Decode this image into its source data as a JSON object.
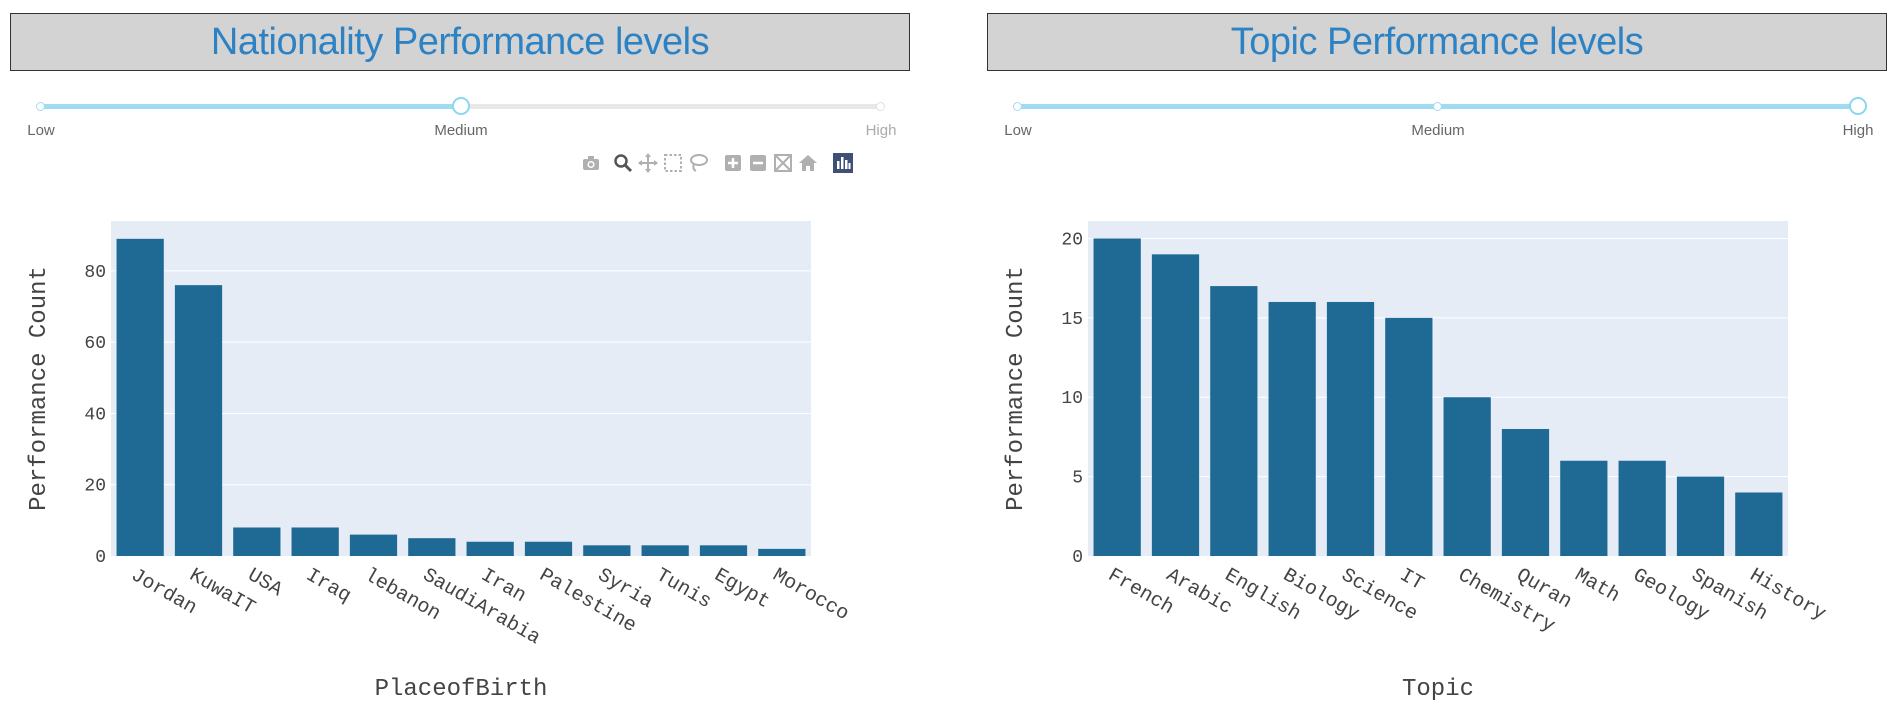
{
  "panels": {
    "left": {
      "title": "Nationality Performance levels",
      "slider": {
        "marks": [
          "Low",
          "Medium",
          "High"
        ],
        "value_index": 1
      }
    },
    "right": {
      "title": "Topic Performance levels",
      "slider": {
        "marks": [
          "Low",
          "Medium",
          "High"
        ],
        "value_index": 2
      }
    }
  },
  "modebar": {
    "icons": [
      "camera-icon",
      "zoom-icon",
      "pan-icon",
      "box-select-icon",
      "lasso-select-icon",
      "zoom-in-icon",
      "zoom-out-icon",
      "autoscale-icon",
      "reset-axes-icon",
      "plotly-logo-icon"
    ]
  },
  "colors": {
    "bar": "#1f6995",
    "plot_bg": "#e5ecf6",
    "title": "#2d82c4",
    "slider_track": "#9fdcf2",
    "title_box": "#d3d3d3"
  },
  "chart_data": [
    {
      "type": "bar",
      "categories": [
        "Jordan",
        "KuwaIT",
        "USA",
        "Iraq",
        "lebanon",
        "SaudiArabia",
        "Iran",
        "Palestine",
        "Syria",
        "Tunis",
        "Egypt",
        "Morocco"
      ],
      "values": [
        89,
        76,
        8,
        8,
        6,
        5,
        4,
        4,
        3,
        3,
        3,
        2
      ],
      "xlabel": "PlaceofBirth",
      "ylabel": "Performance Count",
      "ylim": [
        0,
        94
      ],
      "yticks": [
        0,
        20,
        40,
        60,
        80
      ],
      "grid": true
    },
    {
      "type": "bar",
      "categories": [
        "French",
        "Arabic",
        "English",
        "Biology",
        "Science",
        "IT",
        "Chemistry",
        "Quran",
        "Math",
        "Geology",
        "Spanish",
        "History"
      ],
      "values": [
        20,
        19,
        17,
        16,
        16,
        15,
        10,
        8,
        6,
        6,
        5,
        4
      ],
      "xlabel": "Topic",
      "ylabel": "Performance Count",
      "ylim": [
        0,
        21.1
      ],
      "yticks": [
        0,
        5,
        10,
        15,
        20
      ],
      "grid": true
    }
  ]
}
